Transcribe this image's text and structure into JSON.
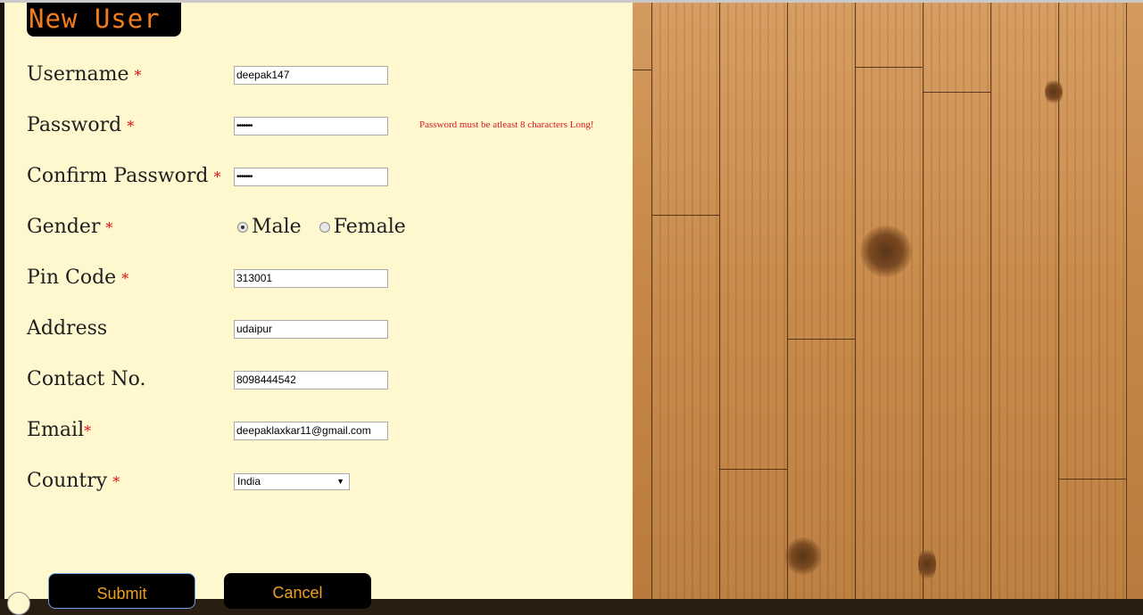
{
  "form": {
    "title": "New User",
    "required_mark": "*",
    "fields": {
      "username": {
        "label": "Username",
        "value": "deepak147"
      },
      "password": {
        "label": "Password",
        "value": "•••••••",
        "error": "Password must be atleast 8 characters Long!"
      },
      "confirm_password": {
        "label": "Confirm Password",
        "value": "•••••••"
      },
      "gender": {
        "label": "Gender",
        "options": [
          "Male",
          "Female"
        ],
        "selected": "Male"
      },
      "pin_code": {
        "label": "Pin Code",
        "value": "313001"
      },
      "address": {
        "label": "Address",
        "value": "udaipur"
      },
      "contact_no": {
        "label": "Contact No.",
        "value": "8098444542"
      },
      "email": {
        "label": "Email",
        "value": "deepaklaxkar11@gmail.com"
      },
      "country": {
        "label": "Country",
        "selected": "India"
      }
    },
    "buttons": {
      "submit": "Submit",
      "cancel": "Cancel"
    }
  },
  "icons": {
    "select_arrow": "▼"
  }
}
